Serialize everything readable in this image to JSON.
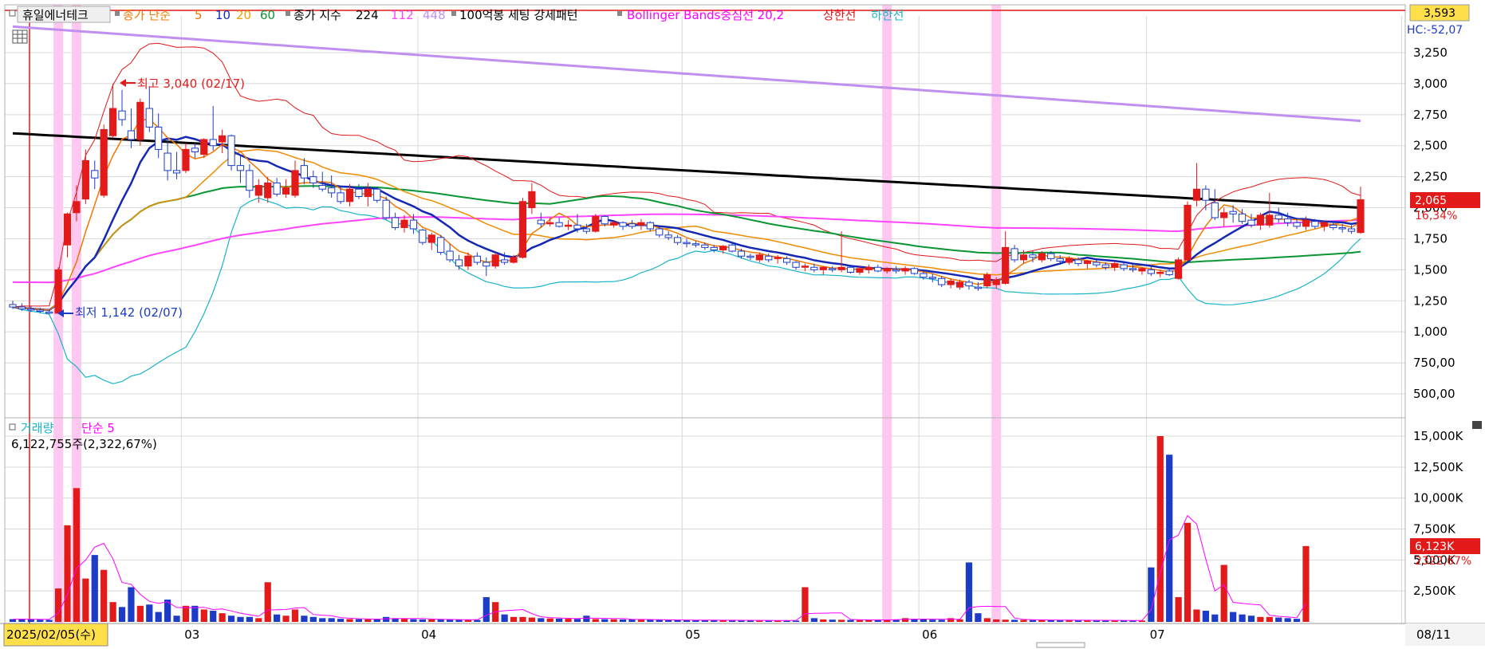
{
  "legend": {
    "stock_name": "휴일에너테크",
    "ma_title": "종가 단순",
    "ma_periods": [
      "5",
      "10",
      "20",
      "60"
    ],
    "ma_colors": [
      "#f07800",
      "#1428b4",
      "#f08c00",
      "#0a9632"
    ],
    "ma_label_colors": [
      "#f07800",
      "#1428b4",
      "#f0a000",
      "#0a9632"
    ],
    "index_title": "종가 지수",
    "index_periods": [
      "224",
      "112",
      "448"
    ],
    "index_colors": [
      "#000000",
      "#ff44ff",
      "#c090f0"
    ],
    "pattern_title": "100억봉 세팅 강세패턴",
    "bb_title": "Bollinger Bands중심선 20,2",
    "bb_upper_label": "상한선",
    "bb_lower_label": "하한선",
    "bb_colors": {
      "center": "#ff00ff",
      "upper": "#e01818",
      "lower": "#18b4c8"
    }
  },
  "price_panel": {
    "axis_ticks": [
      "3,250",
      "3,000",
      "2,750",
      "2,500",
      "2,250",
      "2,000",
      "1,750",
      "1,500",
      "1,250",
      "1,000",
      "750,00",
      "500,00"
    ],
    "top_box_value": "3,593",
    "top_right_label": "HC:-52,07",
    "current_price_label": "2,065",
    "current_change_label": "16,34%",
    "high_annotation": "최고 3,040 (02/17)",
    "low_annotation": "최저 1,142 (02/07)"
  },
  "volume_panel": {
    "title": "거래량",
    "ma_label": "단순 5",
    "info_text": "6,122,755주(2,322,67%)",
    "axis_ticks": [
      "15,000K",
      "12,500K",
      "10,000K",
      "7,500K",
      "5,000K",
      "2,500K"
    ],
    "current_volume_label": "6,123K",
    "current_ratio_label": "2322,67%"
  },
  "x_axis": {
    "cursor_date": "2025/02/05(수)",
    "month_labels": [
      "03",
      "04",
      "05",
      "06",
      "07",
      "08"
    ],
    "right_date": "08/11"
  },
  "colors": {
    "up": "#e31a1a",
    "down": "#1c3cc8",
    "grid": "#d8d8d8",
    "highlight": "#ffc8f0",
    "price_box": "#e31a1a",
    "top_box": "#ffe04a"
  },
  "chart_data": {
    "type": "candlestick",
    "price_ylim": [
      250,
      3593
    ],
    "volume_ylim": [
      0,
      15500000
    ],
    "highlight_bar_indices": [
      5,
      7,
      96,
      108
    ],
    "ohlc": [
      [
        1220,
        1250,
        1185,
        1200
      ],
      [
        1200,
        1230,
        1170,
        1185
      ],
      [
        1185,
        1210,
        1160,
        1175
      ],
      [
        1175,
        1195,
        1150,
        1165
      ],
      [
        1160,
        1180,
        1142,
        1150
      ],
      [
        1150,
        1520,
        1145,
        1500
      ],
      [
        1700,
        1960,
        1600,
        1950
      ],
      [
        1960,
        2180,
        1890,
        2050
      ],
      [
        2070,
        2470,
        2030,
        2380
      ],
      [
        2300,
        2380,
        2150,
        2240
      ],
      [
        2100,
        2670,
        2080,
        2630
      ],
      [
        2580,
        3000,
        2560,
        2800
      ],
      [
        2780,
        2950,
        2660,
        2710
      ],
      [
        2620,
        2800,
        2480,
        2550
      ],
      [
        2550,
        2880,
        2500,
        2850
      ],
      [
        2800,
        2980,
        2610,
        2650
      ],
      [
        2650,
        2760,
        2400,
        2470
      ],
      [
        2440,
        2560,
        2220,
        2300
      ],
      [
        2300,
        2450,
        2230,
        2280
      ],
      [
        2300,
        2520,
        2280,
        2470
      ],
      [
        2480,
        2530,
        2400,
        2450
      ],
      [
        2430,
        2560,
        2400,
        2550
      ],
      [
        2550,
        2820,
        2460,
        2500
      ],
      [
        2530,
        2630,
        2440,
        2580
      ],
      [
        2580,
        2590,
        2300,
        2340
      ],
      [
        2340,
        2430,
        2200,
        2300
      ],
      [
        2300,
        2350,
        2080,
        2140
      ],
      [
        2100,
        2230,
        2040,
        2180
      ],
      [
        2080,
        2250,
        2040,
        2200
      ],
      [
        2200,
        2240,
        2090,
        2110
      ],
      [
        2110,
        2230,
        2080,
        2160
      ],
      [
        2100,
        2380,
        2080,
        2300
      ],
      [
        2340,
        2400,
        2190,
        2240
      ],
      [
        2250,
        2300,
        2160,
        2200
      ],
      [
        2180,
        2290,
        2130,
        2150
      ],
      [
        2160,
        2260,
        2080,
        2120
      ],
      [
        2120,
        2180,
        2030,
        2050
      ],
      [
        2050,
        2190,
        2010,
        2150
      ],
      [
        2150,
        2190,
        2070,
        2090
      ],
      [
        2090,
        2200,
        2010,
        2150
      ],
      [
        2150,
        2170,
        2040,
        2060
      ],
      [
        2060,
        2090,
        1900,
        1920
      ],
      [
        1920,
        1960,
        1820,
        1840
      ],
      [
        1840,
        1940,
        1800,
        1900
      ],
      [
        1900,
        1950,
        1790,
        1830
      ],
      [
        1820,
        1830,
        1700,
        1720
      ],
      [
        1720,
        1800,
        1660,
        1780
      ],
      [
        1760,
        1780,
        1620,
        1640
      ],
      [
        1650,
        1710,
        1560,
        1580
      ],
      [
        1580,
        1620,
        1500,
        1530
      ],
      [
        1530,
        1640,
        1500,
        1610
      ],
      [
        1610,
        1640,
        1540,
        1560
      ],
      [
        1560,
        1600,
        1450,
        1530
      ],
      [
        1530,
        1640,
        1510,
        1620
      ],
      [
        1580,
        1640,
        1540,
        1560
      ],
      [
        1560,
        1620,
        1550,
        1600
      ],
      [
        1600,
        2080,
        1590,
        2050
      ],
      [
        2000,
        2200,
        1950,
        2130
      ],
      [
        1900,
        1960,
        1840,
        1870
      ],
      [
        1870,
        1920,
        1850,
        1880
      ],
      [
        1880,
        1920,
        1840,
        1850
      ],
      [
        1850,
        1900,
        1820,
        1860
      ],
      [
        1860,
        1950,
        1800,
        1830
      ],
      [
        1830,
        1870,
        1790,
        1810
      ],
      [
        1810,
        1950,
        1800,
        1930
      ],
      [
        1930,
        1940,
        1850,
        1870
      ],
      [
        1860,
        1900,
        1840,
        1880
      ],
      [
        1880,
        1890,
        1820,
        1850
      ],
      [
        1870,
        1900,
        1830,
        1850
      ],
      [
        1860,
        1910,
        1820,
        1880
      ],
      [
        1880,
        1890,
        1810,
        1830
      ],
      [
        1830,
        1850,
        1760,
        1780
      ],
      [
        1780,
        1810,
        1740,
        1760
      ],
      [
        1760,
        1780,
        1700,
        1720
      ],
      [
        1720,
        1750,
        1680,
        1710
      ],
      [
        1710,
        1730,
        1680,
        1700
      ],
      [
        1700,
        1720,
        1660,
        1680
      ],
      [
        1680,
        1700,
        1640,
        1660
      ],
      [
        1660,
        1700,
        1630,
        1690
      ],
      [
        1700,
        1720,
        1640,
        1650
      ],
      [
        1650,
        1670,
        1590,
        1610
      ],
      [
        1610,
        1630,
        1580,
        1600
      ],
      [
        1580,
        1640,
        1560,
        1620
      ],
      [
        1610,
        1630,
        1560,
        1580
      ],
      [
        1590,
        1620,
        1550,
        1600
      ],
      [
        1590,
        1610,
        1540,
        1560
      ],
      [
        1560,
        1570,
        1500,
        1520
      ],
      [
        1520,
        1550,
        1490,
        1530
      ],
      [
        1520,
        1550,
        1480,
        1500
      ],
      [
        1500,
        1530,
        1460,
        1520
      ],
      [
        1510,
        1530,
        1480,
        1500
      ],
      [
        1500,
        1810,
        1480,
        1520
      ],
      [
        1520,
        1540,
        1470,
        1480
      ],
      [
        1480,
        1530,
        1460,
        1510
      ],
      [
        1500,
        1540,
        1470,
        1520
      ],
      [
        1520,
        1540,
        1480,
        1490
      ],
      [
        1490,
        1520,
        1470,
        1510
      ],
      [
        1500,
        1530,
        1470,
        1490
      ],
      [
        1490,
        1530,
        1460,
        1510
      ],
      [
        1510,
        1520,
        1460,
        1470
      ],
      [
        1470,
        1500,
        1420,
        1440
      ],
      [
        1440,
        1470,
        1400,
        1430
      ],
      [
        1430,
        1450,
        1360,
        1380
      ],
      [
        1380,
        1430,
        1350,
        1410
      ],
      [
        1360,
        1420,
        1340,
        1400
      ],
      [
        1400,
        1420,
        1340,
        1370
      ],
      [
        1360,
        1400,
        1330,
        1350
      ],
      [
        1370,
        1480,
        1350,
        1460
      ],
      [
        1380,
        1440,
        1350,
        1420
      ],
      [
        1390,
        1810,
        1380,
        1680
      ],
      [
        1670,
        1700,
        1560,
        1580
      ],
      [
        1580,
        1660,
        1550,
        1620
      ],
      [
        1620,
        1650,
        1560,
        1600
      ],
      [
        1580,
        1650,
        1560,
        1630
      ],
      [
        1630,
        1650,
        1570,
        1590
      ],
      [
        1590,
        1620,
        1540,
        1570
      ],
      [
        1560,
        1610,
        1540,
        1590
      ],
      [
        1580,
        1600,
        1530,
        1550
      ],
      [
        1550,
        1580,
        1510,
        1570
      ],
      [
        1560,
        1580,
        1520,
        1540
      ],
      [
        1540,
        1560,
        1500,
        1520
      ],
      [
        1520,
        1570,
        1490,
        1550
      ],
      [
        1540,
        1560,
        1490,
        1510
      ],
      [
        1510,
        1540,
        1480,
        1500
      ],
      [
        1490,
        1520,
        1460,
        1510
      ],
      [
        1500,
        1530,
        1450,
        1470
      ],
      [
        1470,
        1500,
        1440,
        1480
      ],
      [
        1490,
        1510,
        1450,
        1460
      ],
      [
        1430,
        1600,
        1420,
        1580
      ],
      [
        1580,
        2050,
        1570,
        2020
      ],
      [
        2060,
        2360,
        2010,
        2150
      ],
      [
        2150,
        2180,
        1980,
        2060
      ],
      [
        2040,
        2150,
        1900,
        1920
      ],
      [
        1920,
        2000,
        1850,
        1960
      ],
      [
        1970,
        2020,
        1880,
        1950
      ],
      [
        1950,
        1990,
        1870,
        1890
      ],
      [
        1900,
        1950,
        1840,
        1860
      ],
      [
        1860,
        1960,
        1820,
        1940
      ],
      [
        1860,
        2120,
        1840,
        1940
      ],
      [
        1940,
        2000,
        1880,
        1910
      ],
      [
        1910,
        1960,
        1850,
        1880
      ],
      [
        1880,
        1920,
        1830,
        1850
      ],
      [
        1850,
        1930,
        1820,
        1900
      ],
      [
        1890,
        1910,
        1830,
        1850
      ],
      [
        1850,
        1900,
        1810,
        1880
      ],
      [
        1860,
        1890,
        1820,
        1840
      ],
      [
        1840,
        1870,
        1800,
        1830
      ],
      [
        1830,
        1860,
        1790,
        1810
      ],
      [
        1800,
        2170,
        1790,
        2065
      ]
    ],
    "volume": [
      220000,
      230000,
      200000,
      180000,
      160000,
      2700000,
      7800000,
      10800000,
      3500000,
      5400000,
      4200000,
      1600000,
      1200000,
      2800000,
      1300000,
      1400000,
      800000,
      1800000,
      500000,
      1300000,
      1300000,
      1000000,
      900000,
      700000,
      500000,
      400000,
      400000,
      300000,
      3200000,
      600000,
      500000,
      1000000,
      500000,
      400000,
      300000,
      300000,
      250000,
      230000,
      220000,
      210000,
      200000,
      400000,
      300000,
      250000,
      220000,
      200000,
      200000,
      190000,
      180000,
      170000,
      160000,
      160000,
      2000000,
      1600000,
      600000,
      400000,
      400000,
      350000,
      300000,
      280000,
      260000,
      250000,
      240000,
      500000,
      230000,
      220000,
      210000,
      200000,
      190000,
      180000,
      170000,
      160000,
      150000,
      150000,
      150000,
      140000,
      140000,
      130000,
      130000,
      130000,
      120000,
      120000,
      120000,
      110000,
      110000,
      110000,
      110000,
      2800000,
      300000,
      200000,
      180000,
      170000,
      160000,
      150000,
      160000,
      170000,
      180000,
      200000,
      300000,
      250000,
      200000,
      180000,
      170000,
      300000,
      200000,
      4800000,
      700000,
      300000,
      200000,
      180000,
      170000,
      160000,
      150000,
      150000,
      140000,
      140000,
      130000,
      130000,
      130000,
      120000,
      120000,
      120000,
      110000,
      110000,
      110000,
      4400000,
      15000000,
      13500000,
      2000000,
      8000000,
      1000000,
      900000,
      600000,
      4600000,
      800000,
      600000,
      500000,
      400000,
      400000,
      350000,
      300000,
      250000,
      6122755
    ]
  }
}
